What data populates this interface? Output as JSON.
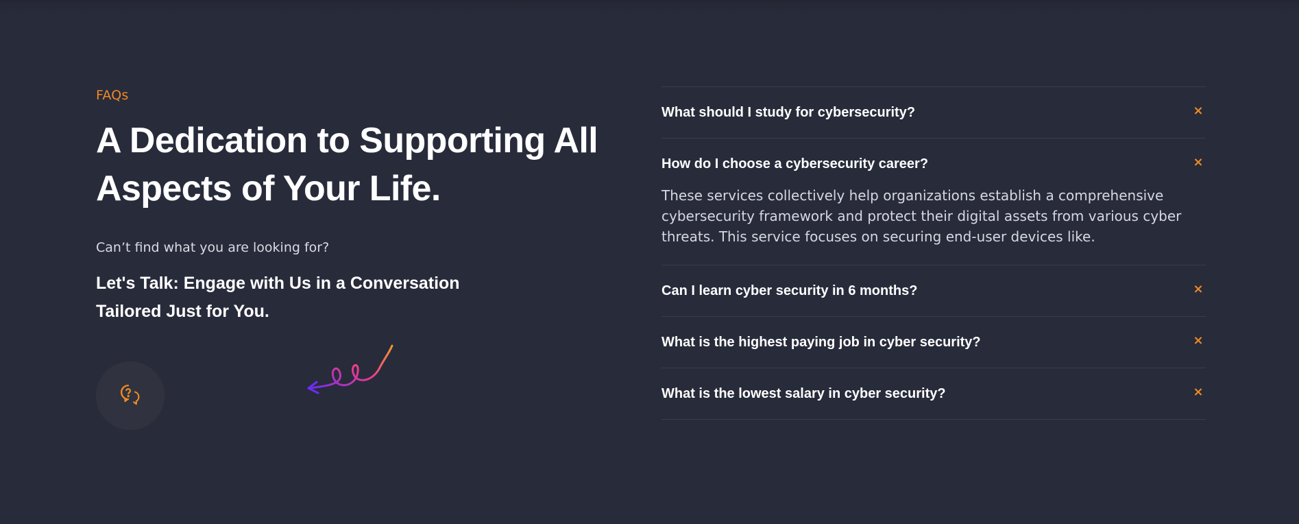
{
  "section": {
    "eyebrow": "FAQs",
    "headline": "A Dedication to Supporting All Aspects of Your Life.",
    "subtext": "Can’t find what you are looking for?",
    "cta": "Let's Talk: Engage with Us in a Conversation Tailored Just for You.",
    "help_icon": "chat-question-icon"
  },
  "colors": {
    "background": "#282b3a",
    "accent": "#f08a24"
  },
  "faq": {
    "items": [
      {
        "question": "What should I study for cybersecurity?",
        "toggle": "×",
        "expanded": false,
        "answer": ""
      },
      {
        "question": "How do I choose a cybersecurity career?",
        "toggle": "×",
        "expanded": true,
        "answer": "These services collectively help organizations establish a comprehensive cybersecurity framework and protect their digital assets from various cyber threats. This service focuses on securing end-user devices like."
      },
      {
        "question": "Can I learn cyber security in 6 months?",
        "toggle": "×",
        "expanded": false,
        "answer": ""
      },
      {
        "question": "What is the highest paying job in cyber security?",
        "toggle": "×",
        "expanded": false,
        "answer": ""
      },
      {
        "question": "What is the lowest salary in cyber security?",
        "toggle": "×",
        "expanded": false,
        "answer": ""
      }
    ]
  }
}
